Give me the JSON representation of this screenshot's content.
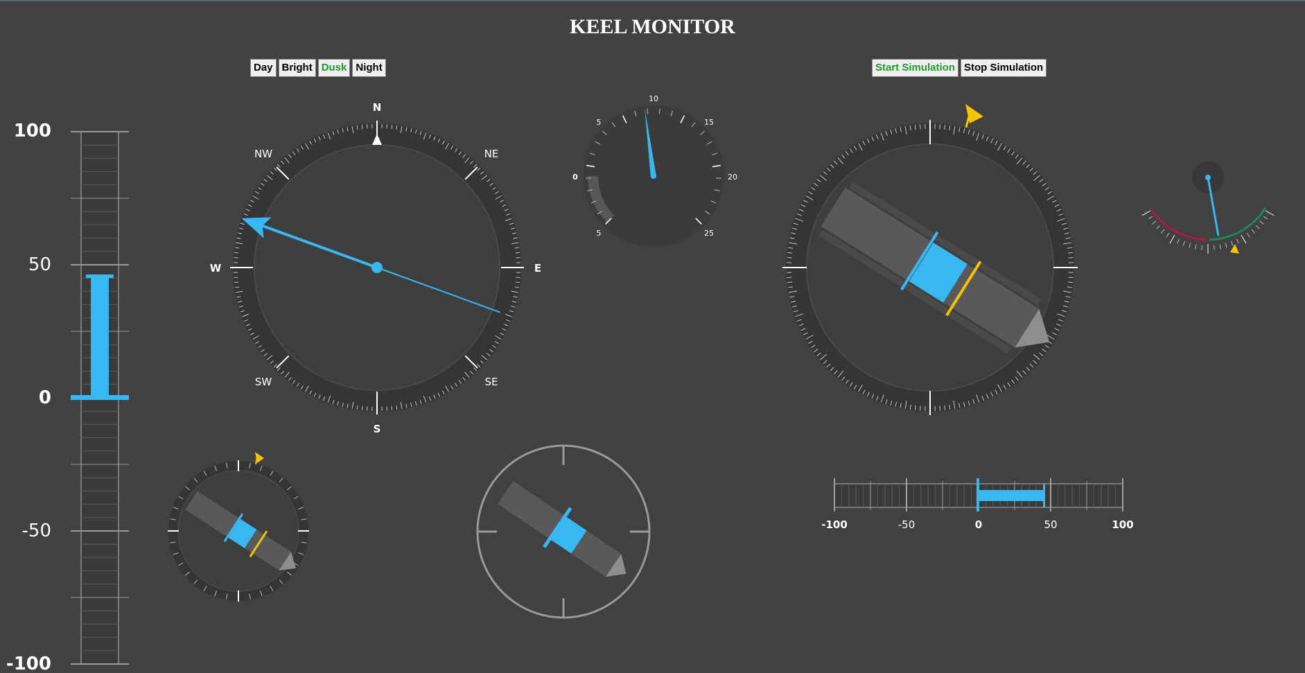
{
  "title": "KEEL MONITOR",
  "theme_buttons": [
    {
      "label": "Day",
      "active": false
    },
    {
      "label": "Bright",
      "active": false
    },
    {
      "label": "Dusk",
      "active": true
    },
    {
      "label": "Night",
      "active": false
    }
  ],
  "sim_buttons": [
    {
      "label": "Start Simulation",
      "active": true
    },
    {
      "label": "Stop Simulation",
      "active": false
    }
  ],
  "vertical_bar": {
    "labels": [
      "100",
      "50",
      "0",
      "-50",
      "-100"
    ],
    "value": 46,
    "range": [
      -100,
      100
    ]
  },
  "compass": {
    "cardinals": {
      "n": "N",
      "e": "E",
      "s": "S",
      "w": "W"
    },
    "intercardinals": {
      "ne": "NE",
      "se": "SE",
      "sw": "SW",
      "nw": "NW"
    },
    "heading_deg": 290
  },
  "speed_gauge": {
    "labels": {
      "l0": "0",
      "l5_top": "5",
      "l10": "10",
      "l15": "15",
      "l20": "20",
      "l25": "25",
      "l5_bottom": "5"
    },
    "value": 9.5
  },
  "horizontal_bar": {
    "labels": [
      "-100",
      "-50",
      "0",
      "50",
      "100"
    ],
    "value": 46,
    "range": [
      -100,
      100
    ]
  },
  "colors": {
    "background": "#414141",
    "accent": "#38b8f2",
    "marker": "#f5c400",
    "active_button_text": "#1f9a2e",
    "port": "#b0174a",
    "starboard": "#1b8a5a"
  }
}
